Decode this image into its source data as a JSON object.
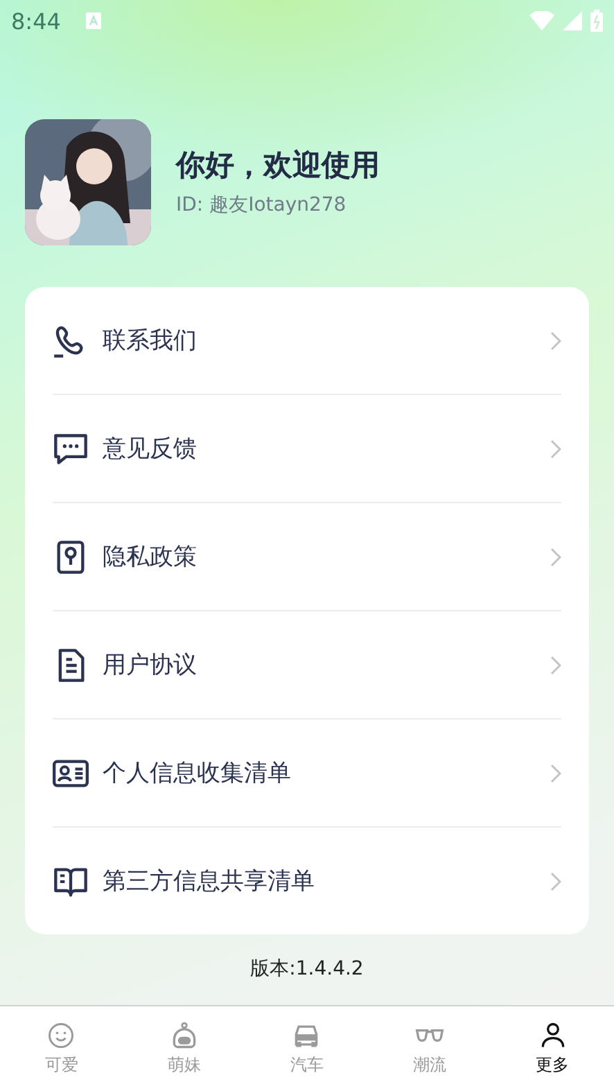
{
  "status_bar": {
    "time": "8:44"
  },
  "profile": {
    "greeting": "你好，欢迎使用",
    "user_id": "ID: 趣友Iotayn278"
  },
  "menu": [
    {
      "label": "联系我们"
    },
    {
      "label": "意见反馈"
    },
    {
      "label": "隐私政策"
    },
    {
      "label": "用户协议"
    },
    {
      "label": "个人信息收集清单"
    },
    {
      "label": "第三方信息共享清单"
    }
  ],
  "version": "版本:1.4.4.2",
  "tabs": [
    {
      "label": "可爱",
      "selected": false
    },
    {
      "label": "萌妹",
      "selected": false
    },
    {
      "label": "汽车",
      "selected": false
    },
    {
      "label": "潮流",
      "selected": false
    },
    {
      "label": "更多",
      "selected": true
    }
  ]
}
